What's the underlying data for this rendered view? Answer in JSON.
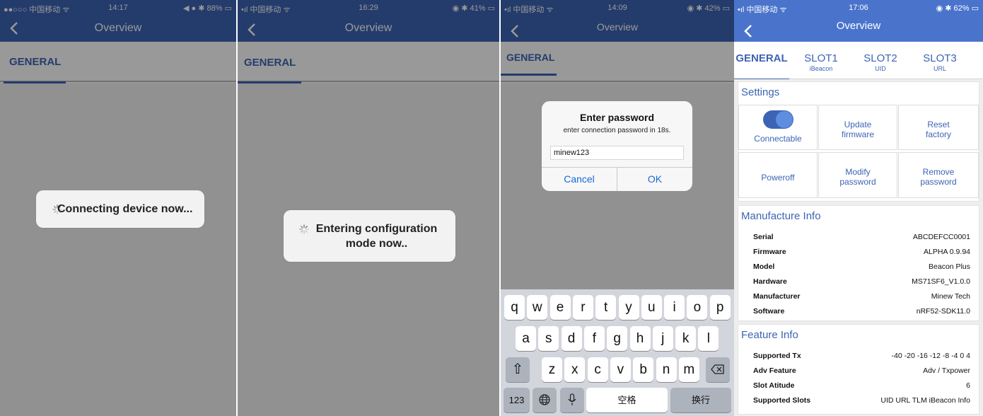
{
  "screens": [
    {
      "status": {
        "left": "●●○○○ 中国移动 ᯤ",
        "time": "14:17",
        "right": "◀ ● ✱ 88% ▭"
      },
      "title": "Overview",
      "tab": "GENERAL",
      "hud": "Connecting device now..."
    },
    {
      "status": {
        "left": "•ıl 中国移动 ᯤ",
        "time": "16:29",
        "right": "◉ ✱ 41% ▭"
      },
      "title": "Overview",
      "tab": "GENERAL",
      "hud": [
        "Entering configuration",
        "mode now.."
      ]
    },
    {
      "status": {
        "left": "•ıl 中国移动 ᯤ",
        "time": "14:09",
        "right": "◉ ✱ 42% ▭"
      },
      "title": "Overview",
      "tab": "GENERAL",
      "alert": {
        "title": "Enter password",
        "message": "enter connection password in 18s.",
        "value": "minew123",
        "cancel": "Cancel",
        "ok": "OK"
      },
      "keyboard": {
        "row1": [
          "q",
          "w",
          "e",
          "r",
          "t",
          "y",
          "u",
          "i",
          "o",
          "p"
        ],
        "row2": [
          "a",
          "s",
          "d",
          "f",
          "g",
          "h",
          "j",
          "k",
          "l"
        ],
        "row3": [
          "z",
          "x",
          "c",
          "v",
          "b",
          "n",
          "m"
        ],
        "num": "123",
        "space": "空格",
        "return": "换行"
      }
    },
    {
      "status": {
        "left": "•ıl 中国移动 ᯤ",
        "time": "17:06",
        "right": "◉ ✱ 62% ▭"
      },
      "title": "Overview",
      "tabs": [
        {
          "label": "GENERAL",
          "sub": ""
        },
        {
          "label": "SLOT1",
          "sub": "iBeacon"
        },
        {
          "label": "SLOT2",
          "sub": "UID"
        },
        {
          "label": "SLOT3",
          "sub": "URL"
        }
      ],
      "settings": {
        "title": "Settings",
        "tiles": [
          "Connectable",
          [
            "Update",
            "firmware"
          ],
          [
            "Reset",
            "factory"
          ],
          "Poweroff",
          [
            "Modify",
            "password"
          ],
          [
            "Remove",
            "password"
          ]
        ],
        "connectable_on": true
      },
      "manufacture": {
        "title": "Manufacture Info",
        "rows": [
          {
            "k": "Serial",
            "v": "ABCDEFCC0001"
          },
          {
            "k": "Firmware",
            "v": "ALPHA 0.9.94"
          },
          {
            "k": "Model",
            "v": "Beacon Plus"
          },
          {
            "k": "Hardware",
            "v": "MS71SF6_V1.0.0"
          },
          {
            "k": "Manufacturer",
            "v": "Minew Tech"
          },
          {
            "k": "Software",
            "v": "nRF52-SDK11.0"
          }
        ]
      },
      "feature": {
        "title": "Feature Info",
        "rows": [
          {
            "k": "Supported Tx",
            "v": "-40 -20 -16 -12 -8 -4 0 4"
          },
          {
            "k": "Adv Feature",
            "v": "Adv / Txpower"
          },
          {
            "k": "Slot Atitude",
            "v": "6"
          },
          {
            "k": "Supported Slots",
            "v": "UID URL TLM iBeacon Info"
          }
        ]
      }
    }
  ]
}
